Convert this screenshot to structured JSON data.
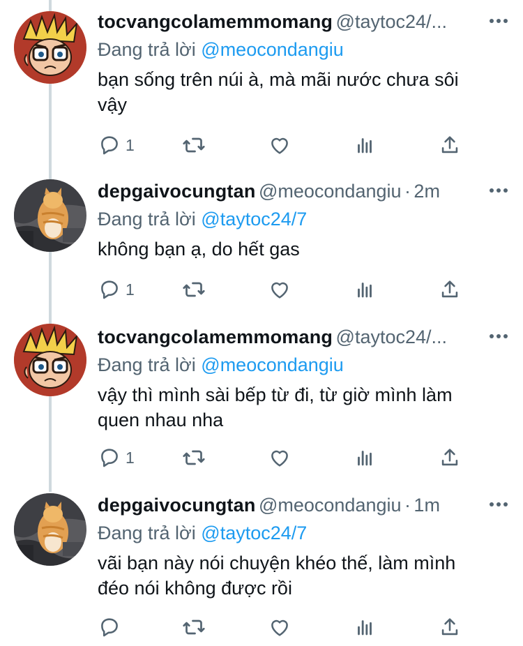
{
  "tweets": [
    {
      "name": "tocvangcolamemmomang",
      "handle": "@taytoc24/...",
      "separator": "",
      "time": "",
      "replying_label": "Đang trả lời",
      "replying_to": "@meocondangiu",
      "text_lines": [
        "bạn sống trên núi à, mà mãi nước chưa sôi",
        "vậy"
      ],
      "reply_count": "1",
      "avatar": "cartoon-avatar"
    },
    {
      "name": "depgaivocungtan",
      "handle": "@meocondangiu",
      "separator": "·",
      "time": "2m",
      "replying_label": "Đang trả lời",
      "replying_to": "@taytoc24/7",
      "text_lines": [
        "không bạn ạ, do hết gas"
      ],
      "reply_count": "1",
      "avatar": "cat-photo-avatar"
    },
    {
      "name": "tocvangcolamemmomang",
      "handle": "@taytoc24/...",
      "separator": "",
      "time": "",
      "replying_label": "Đang trả lời",
      "replying_to": "@meocondangiu",
      "text_lines": [
        "vậy thì mình sài bếp từ đi, từ giờ mình làm",
        "quen nhau nha"
      ],
      "reply_count": "1",
      "avatar": "cartoon-avatar"
    },
    {
      "name": "depgaivocungtan",
      "handle": "@meocondangiu",
      "separator": "·",
      "time": "1m",
      "replying_label": "Đang trả lời",
      "replying_to": "@taytoc24/7",
      "text_lines": [
        "vãi bạn này nói chuyện khéo thế, làm mình",
        "đéo nói không được rồi"
      ],
      "reply_count": "",
      "avatar": "cat-photo-avatar"
    }
  ],
  "colors": {
    "link": "#1d9bf0",
    "secondary": "#536471",
    "text": "#0f1419",
    "thread_line": "#cfd9de"
  },
  "icons": [
    "reply-icon",
    "retweet-icon",
    "like-icon",
    "analytics-icon",
    "share-icon",
    "more-icon"
  ]
}
